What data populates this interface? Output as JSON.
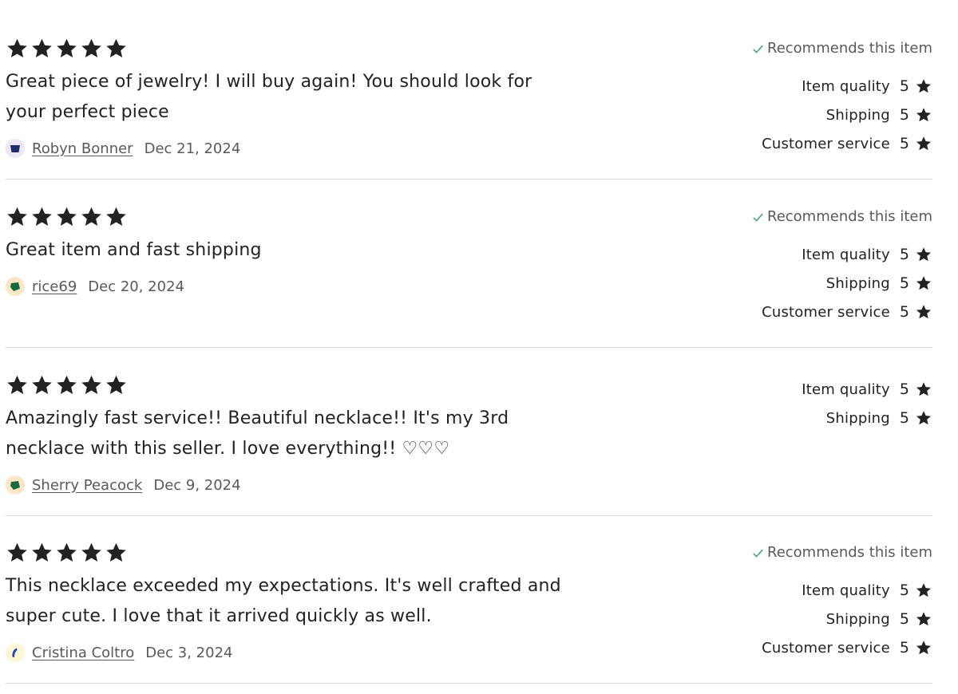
{
  "colors": {
    "star": "#222222",
    "check": "#3e9b6c",
    "avatar_bg_purple": "#ece6f5",
    "avatar_bg_peach": "#fbe7c8",
    "avatar_bg_yellow": "#fdf7d8",
    "avatar_shape_navy": "#1f2d6b",
    "avatar_shape_green": "#176b3a",
    "avatar_shape_blue": "#2845b3"
  },
  "reviews": [
    {
      "stars": 5,
      "text": "Great piece of jewelry! I will buy again! You should look for your perfect piece",
      "reviewer": "Robyn Bonner",
      "date": "Dec 21, 2024",
      "recommends": "Recommends this item",
      "ratings": [
        {
          "label": "Item quality",
          "value": "5"
        },
        {
          "label": "Shipping",
          "value": "5"
        },
        {
          "label": "Customer service",
          "value": "5"
        }
      ]
    },
    {
      "stars": 5,
      "text": "Great item and fast shipping",
      "reviewer": "rice69",
      "date": "Dec 20, 2024",
      "recommends": "Recommends this item",
      "ratings": [
        {
          "label": "Item quality",
          "value": "5"
        },
        {
          "label": "Shipping",
          "value": "5"
        },
        {
          "label": "Customer service",
          "value": "5"
        }
      ]
    },
    {
      "stars": 5,
      "text": "Amazingly fast service!! Beautiful necklace!! It's my 3rd necklace with this seller. I love everything!! ♡♡♡",
      "reviewer": "Sherry Peacock",
      "date": "Dec 9, 2024",
      "ratings": [
        {
          "label": "Item quality",
          "value": "5"
        },
        {
          "label": "Shipping",
          "value": "5"
        }
      ]
    },
    {
      "stars": 5,
      "text": "This necklace exceeded my expectations. It's well crafted and super cute. I love that it arrived quickly as well.",
      "reviewer": "Cristina Coltro",
      "date": "Dec 3, 2024",
      "recommends": "Recommends this item",
      "ratings": [
        {
          "label": "Item quality",
          "value": "5"
        },
        {
          "label": "Shipping",
          "value": "5"
        },
        {
          "label": "Customer service",
          "value": "5"
        }
      ]
    }
  ]
}
